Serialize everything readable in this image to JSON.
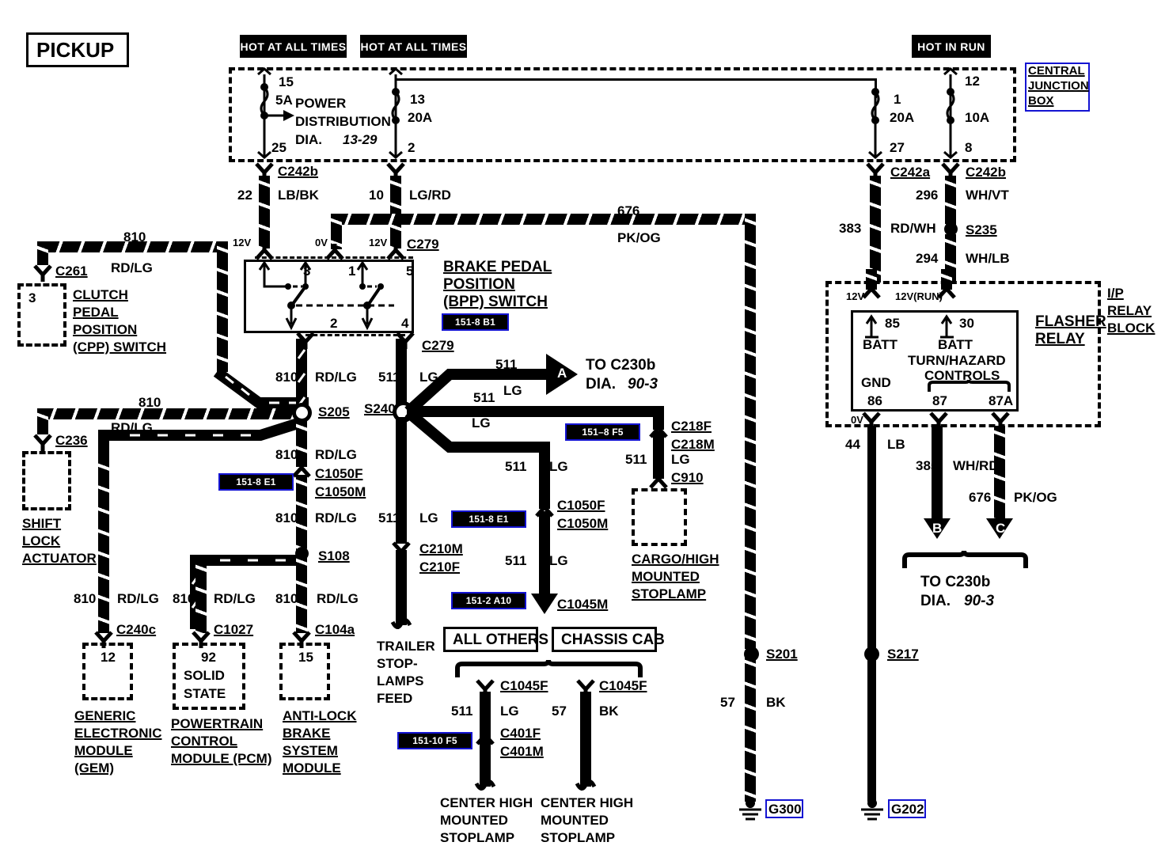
{
  "title_box": {
    "label": "PICKUP"
  },
  "power_banners": [
    {
      "name": "hot-at-all-times-1",
      "label": "HOT AT ALL TIMES"
    },
    {
      "name": "hot-at-all-times-2",
      "label": "HOT AT ALL TIMES"
    },
    {
      "name": "hot-in-run",
      "label": "HOT IN RUN"
    }
  ],
  "central_junction_box": {
    "label_lines": [
      "CENTRAL",
      "JUNCTION",
      "BOX"
    ],
    "accent": "#1414d2",
    "power_distribution": {
      "line1": "POWER",
      "line2": "DISTRIBUTION",
      "line3": "DIA.",
      "ref": "13-29"
    },
    "fuses": [
      {
        "name": "fuse-15",
        "top_pin": "15",
        "rating": "5A",
        "bottom_pin": "25"
      },
      {
        "name": "fuse-13",
        "top_pin": "13",
        "rating": "20A",
        "bottom_pin": "2"
      },
      {
        "name": "fuse-1",
        "top_pin": "1",
        "rating": "20A",
        "bottom_pin": "27"
      },
      {
        "name": "fuse-12",
        "top_pin": "12",
        "rating": "10A",
        "bottom_pin": "8"
      }
    ]
  },
  "ip_relay_block": {
    "label_lines": [
      "I/P",
      "RELAY",
      "BLOCK"
    ],
    "flasher_relay": {
      "label_lines": [
        "FLASHER",
        "RELAY"
      ],
      "pin_85": "85",
      "pin_85_label": "BATT",
      "pin_30": "30",
      "pin_30_label": "BATT",
      "controls_line1": "TURN/HAZARD",
      "controls_line2": "CONTROLS",
      "gnd_label": "GND",
      "pin_86": "86",
      "pin_87": "87",
      "pin_87a": "87A",
      "v_in_left": "12V",
      "v_in_right": "12V(RUN)",
      "v_out": "0V"
    }
  },
  "components": [
    {
      "name": "clutch-pedal-position-switch",
      "pin": "3",
      "connector": "C261",
      "lines": [
        "CLUTCH",
        "PEDAL",
        "POSITION",
        "(CPP) SWITCH"
      ]
    },
    {
      "name": "shift-lock-actuator",
      "connector": "C236",
      "lines": [
        "SHIFT",
        "LOCK",
        "ACTUATOR"
      ]
    },
    {
      "name": "generic-electronic-module",
      "pin": "12",
      "connector": "C240c",
      "lines": [
        "GENERIC",
        "ELECTRONIC",
        "MODULE",
        "(GEM)"
      ]
    },
    {
      "name": "powertrain-control-module",
      "pin": "92",
      "connector": "C1027",
      "inner_lines": [
        "SOLID",
        "STATE"
      ],
      "lines": [
        "POWERTRAIN",
        "CONTROL",
        "MODULE (PCM)"
      ]
    },
    {
      "name": "anti-lock-brake-system-module",
      "pin": "15",
      "connector": "C104a",
      "lines": [
        "ANTI-LOCK",
        "BRAKE",
        "SYSTEM",
        "MODULE"
      ]
    },
    {
      "name": "cargo-high-mounted-stoplamp",
      "connector": "C910",
      "lines": [
        "CARGO/HIGH",
        "MOUNTED",
        "STOPLAMP"
      ]
    },
    {
      "name": "center-high-mounted-stoplamp-all-others",
      "lines": [
        "CENTER HIGH",
        "MOUNTED",
        "STOPLAMP"
      ]
    },
    {
      "name": "center-high-mounted-stoplamp-chassis-cab",
      "lines": [
        "CENTER HIGH",
        "MOUNTED",
        "STOPLAMP"
      ]
    }
  ],
  "bpp_switch": {
    "title_lines": [
      "BRAKE PEDAL",
      "POSITION",
      "(BPP) SWITCH"
    ],
    "top_pins": [
      "3",
      "1",
      "5"
    ],
    "bottom_pins": [
      "2",
      "4"
    ],
    "callout": "151-8 B1",
    "connector_top": "C279",
    "connector_bottom": "C279"
  },
  "variant_boxes": [
    {
      "name": "all-others-box",
      "label": "ALL OTHERS"
    },
    {
      "name": "chassis-cab-box",
      "label": "CHASSIS CAB"
    }
  ],
  "connectors": [
    {
      "name": "c242b-left",
      "label": "C242b"
    },
    {
      "name": "c279-upper",
      "label": "C279"
    },
    {
      "name": "c242a",
      "label": "C242a"
    },
    {
      "name": "c242b-right",
      "label": "C242b"
    },
    {
      "name": "c279-lower",
      "label": "C279"
    },
    {
      "name": "c1050f-upper",
      "label": "C1050F"
    },
    {
      "name": "c1050m-upper",
      "label": "C1050M"
    },
    {
      "name": "c1050f-lower",
      "label": "C1050F"
    },
    {
      "name": "c1050m-lower",
      "label": "C1050M"
    },
    {
      "name": "c210m",
      "label": "C210M"
    },
    {
      "name": "c210f",
      "label": "C210F"
    },
    {
      "name": "c218f",
      "label": "C218F"
    },
    {
      "name": "c218m",
      "label": "C218M"
    },
    {
      "name": "c1045m",
      "label": "C1045M"
    },
    {
      "name": "c1045f-left",
      "label": "C1045F"
    },
    {
      "name": "c1045f-right",
      "label": "C1045F"
    },
    {
      "name": "c401f",
      "label": "C401F"
    },
    {
      "name": "c401m",
      "label": "C401M"
    }
  ],
  "splices": [
    {
      "name": "s205",
      "label": "S205"
    },
    {
      "name": "s240",
      "label": "S240"
    },
    {
      "name": "s108",
      "label": "S108"
    },
    {
      "name": "s235",
      "label": "S235"
    },
    {
      "name": "s201",
      "label": "S201"
    },
    {
      "name": "s217",
      "label": "S217"
    }
  ],
  "grounds": [
    {
      "name": "g300",
      "label": "G300"
    },
    {
      "name": "g202",
      "label": "G202"
    }
  ],
  "wire_labels": [
    {
      "name": "wire-22-lbbk",
      "num": "22",
      "color": "LB/BK"
    },
    {
      "name": "wire-10-lgrd",
      "num": "10",
      "color": "LG/RD"
    },
    {
      "name": "wire-676-pkog-top",
      "num": "676",
      "color": "PK/OG"
    },
    {
      "name": "wire-296-whvt",
      "num": "296",
      "color": "WH/VT"
    },
    {
      "name": "wire-383-rdwh",
      "num": "383",
      "color": "RD/WH"
    },
    {
      "name": "wire-294-whlb",
      "num": "294",
      "color": "WH/LB"
    },
    {
      "name": "wire-810-rdlg-cpp",
      "num": "810",
      "color": "RD/LG"
    },
    {
      "name": "wire-810-rdlg-s205a",
      "num": "810",
      "color": "RD/LG"
    },
    {
      "name": "wire-810-rdlg-c236",
      "num": "810",
      "color": "RD/LG"
    },
    {
      "name": "wire-810-rdlg-s205b",
      "num": "810",
      "color": "RD/LG"
    },
    {
      "name": "wire-810-rdlg-s205c",
      "num": "810",
      "color": "RD/LG"
    },
    {
      "name": "wire-810-rdlg-gem",
      "num": "810",
      "color": "RD/LG"
    },
    {
      "name": "wire-810-rdlg-pcm",
      "num": "810",
      "color": "RD/LG"
    },
    {
      "name": "wire-810-rdlg-abs",
      "num": "810",
      "color": "RD/LG"
    },
    {
      "name": "wire-511-lg-s240",
      "num": "511",
      "color": "LG"
    },
    {
      "name": "wire-511-lg-a",
      "num": "511",
      "color": "LG"
    },
    {
      "name": "wire-511-lg-c218",
      "num": "511",
      "color": "LG"
    },
    {
      "name": "wire-511-lg-c1050",
      "num": "511",
      "color": "LG"
    },
    {
      "name": "wire-511-lg-c910",
      "num": "511",
      "color": "LG"
    },
    {
      "name": "wire-511-lg-c210",
      "num": "511",
      "color": "LG"
    },
    {
      "name": "wire-511-lg-c1045m",
      "num": "511",
      "color": "LG"
    },
    {
      "name": "wire-511-lg-chmsl1",
      "num": "511",
      "color": "LG"
    },
    {
      "name": "wire-511-lg-chmsl2",
      "num": "511",
      "color": "LG"
    },
    {
      "name": "wire-57-bk-relay",
      "num": "57",
      "color": "BK"
    },
    {
      "name": "wire-44-lb",
      "num": "44",
      "color": "LB"
    },
    {
      "name": "wire-385-whrd",
      "num": "385",
      "color": "WH/RD"
    },
    {
      "name": "wire-676-pkog-g300",
      "num": "676",
      "color": "PK/OG"
    },
    {
      "name": "wire-57-bk-g202",
      "num": "57",
      "color": "BK"
    }
  ],
  "voltages": [
    "12V",
    "0V",
    "12V"
  ],
  "callouts": [
    {
      "name": "callout-bpp",
      "label": "151-8 B1"
    },
    {
      "name": "callout-s205-left",
      "label": "151-8 E1"
    },
    {
      "name": "callout-c218",
      "label": "151–8 F5"
    },
    {
      "name": "callout-c1050-lower",
      "label": "151-8 E1"
    },
    {
      "name": "callout-c1045m",
      "label": "151-2 A10"
    },
    {
      "name": "callout-c401",
      "label": "151-10 F5"
    }
  ],
  "offpage_refs": [
    {
      "name": "offpage-a",
      "letter": "A",
      "line1": "TO C230b",
      "line2": "DIA.",
      "ref": "90-3"
    },
    {
      "name": "offpage-b",
      "letter": "B"
    },
    {
      "name": "offpage-c",
      "letter": "C"
    },
    {
      "name": "offpage-bc-dest",
      "line1": "TO C230b",
      "line2": "DIA.",
      "ref": "90-3"
    }
  ],
  "trailer_feed": {
    "lines": [
      "TRAILER",
      "STOP-",
      "LAMPS",
      "FEED"
    ]
  }
}
